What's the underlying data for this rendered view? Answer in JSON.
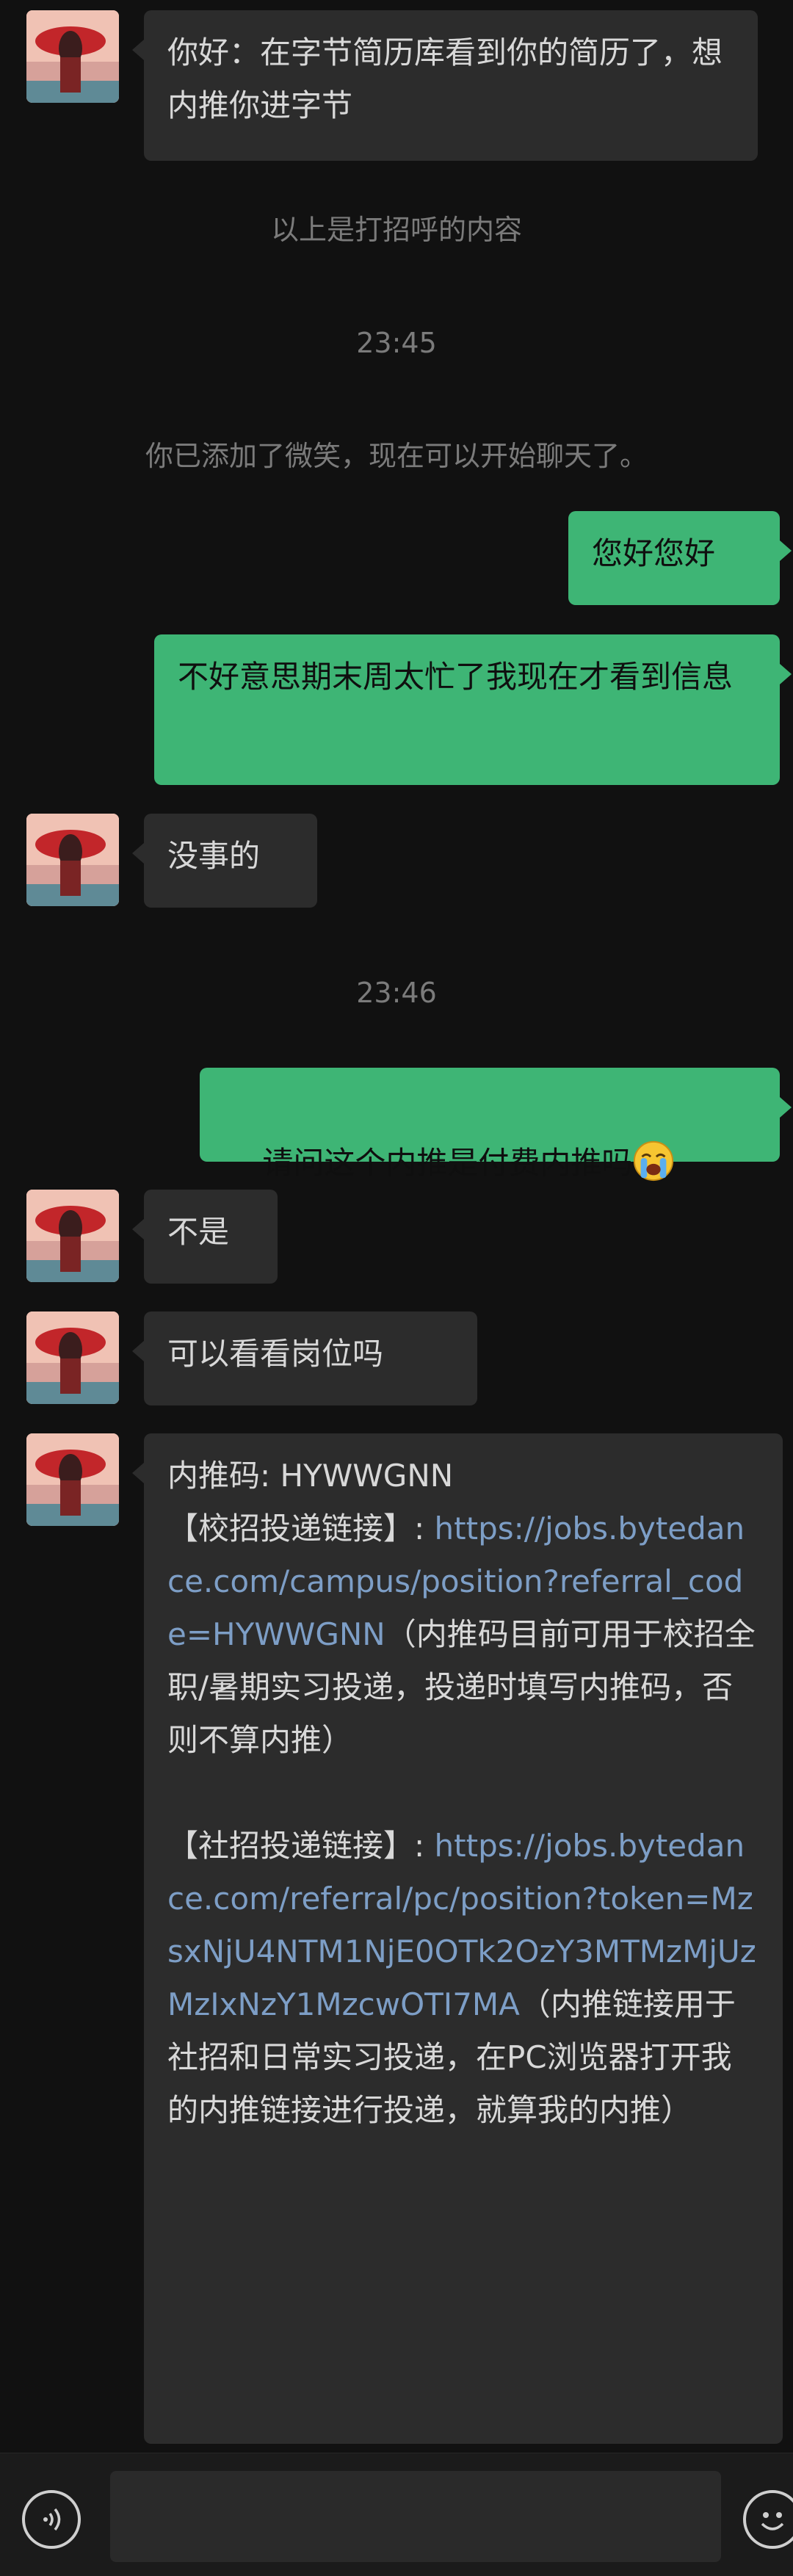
{
  "messages": [
    {
      "side": "in",
      "text": "你好：在字节简历库看到你的简历了，想内推你进字节"
    },
    {
      "side": "sys",
      "text": "以上是打招呼的内容"
    },
    {
      "side": "sys",
      "text": "23:45"
    },
    {
      "side": "sys",
      "text": "你已添加了微笑，现在可以开始聊天了。"
    },
    {
      "side": "out",
      "text": "您好您好"
    },
    {
      "side": "out",
      "text": "不好意思期末周太忙了我现在才看到信息"
    },
    {
      "side": "in",
      "text": "没事的"
    },
    {
      "side": "sys",
      "text": "23:46"
    },
    {
      "side": "out",
      "text": "请问这个内推是付费内推吗"
    },
    {
      "side": "in",
      "text": "不是"
    },
    {
      "side": "in",
      "text": "可以看看岗位吗"
    },
    {
      "side": "in",
      "text": "内推码: HYWWGNN"
    }
  ],
  "referral": {
    "code_line": "内推码: HYWWGNN",
    "campus_label": "【校招投递链接】: ",
    "campus_link": "https://jobs.bytedance.com/campus/position?referral_code=HYWWGNN",
    "campus_note": "（内推码目前可用于校招全职/暑期实习投递，投递时填写内推码，否则不算内推）",
    "social_label": "【社招投递链接】: ",
    "social_link": "https://jobs.bytedance.com/referral/pc/position?token=MzsxNjU4NTM1NjE0OTk2OzY3MTMzMjUzMzIxNzY1MzcwOTI7MA",
    "social_note": "（内推链接用于社招和日常实习投递，在PC浏览器打开我的内推链接进行投递，就算我的内推）"
  },
  "emoji": {
    "cry": "loudly-crying-face"
  },
  "colors": {
    "background": "#111111",
    "incoming_bubble": "#2c2c2c",
    "outgoing_bubble": "#3eb575",
    "link": "#7d9ec6",
    "system_text": "#7b7b7b"
  },
  "input": {
    "placeholder": ""
  }
}
